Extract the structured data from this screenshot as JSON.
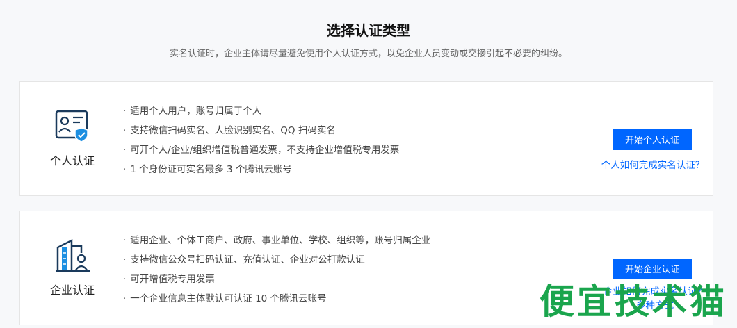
{
  "page": {
    "title": "选择认证类型",
    "subtitle": "实名认证时，企业主体请尽量避免使用个人认证方式，以免企业人员变动或交接引起不必要的纠纷。"
  },
  "cards": [
    {
      "name": "个人认证",
      "icon": "id-card-shield-icon",
      "features": [
        "适用个人用户，账号归属于个人",
        "支持微信扫码实名、人脸识别实名、QQ 扫码实名",
        "可开个人/企业/组织增值税普通发票，不支持企业增值税专用发票",
        "1 个身份证可实名最多 3 个腾讯云账号"
      ],
      "button": "开始个人认证",
      "help": "个人如何完成实名认证？"
    },
    {
      "name": "企业认证",
      "icon": "building-person-icon",
      "features": [
        "适用企业、个体工商户、政府、事业单位、学校、组织等，账号归属企业",
        "支持微信公众号扫码认证、充值认证、企业对公打款认证",
        "可开增值税专用发票",
        "一个企业信息主体默认可认证 10 个腾讯云账号"
      ],
      "button": "开始企业认证",
      "help": "企业如何完成实名认证？多种方式"
    }
  ],
  "watermark": "便宜技术猫",
  "colors": {
    "accent": "#0066ff",
    "watermark": "#1aa54d",
    "icon": "#1a3a5c"
  }
}
